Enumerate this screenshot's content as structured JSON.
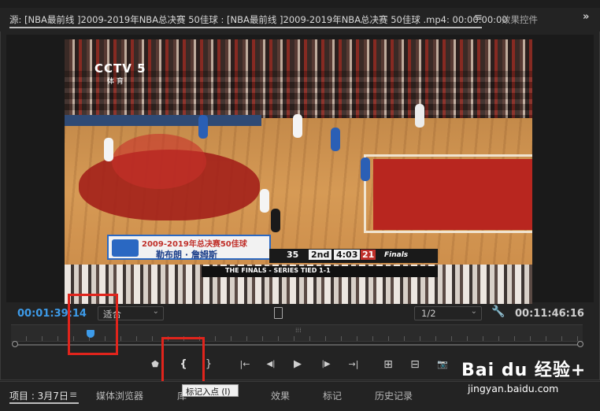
{
  "source_tab": {
    "label": "源: [NBA最前线 ]2009-2019年NBA总决赛 50佳球 : [NBA最前线 ]2009-2019年NBA总决赛 50佳球 .mp4: 00:00:00:00",
    "menu_glyph": "≡"
  },
  "effects_tab": {
    "label": "效果控件"
  },
  "overflow_glyph": "»",
  "video": {
    "cctv_logo": "CCTV 5",
    "cctv_sub": "体 育",
    "scorebug": {
      "title": "2009-2019年总决赛50佳球",
      "player_name": "勒布朗 · 詹姆斯",
      "score_home": "35",
      "quarter": "2nd",
      "clock": "4:03",
      "shot_clock": "21",
      "finals_logo": "Finals",
      "banner": "THE FINALS - SERIES TIED 1-1"
    },
    "court_text": "lines"
  },
  "controls_bar": {
    "timecode_current": "00:01:39:14",
    "fit_value": "适合",
    "resolution_value": "1/2",
    "timecode_duration": "00:11:46:16"
  },
  "transport": {
    "add_marker": "⬟",
    "mark_in": "{",
    "mark_out": "}",
    "go_to_in": "|←",
    "step_back": "◀|",
    "play": "▶",
    "step_forward": "|▶",
    "go_to_out": "→|",
    "insert": "⊞",
    "overwrite": "⊟",
    "export_frame": "📷"
  },
  "tooltip": {
    "text": "标记入点 (I)"
  },
  "bottom_tabs": [
    {
      "label": "项目 : 3月7日",
      "active": true
    },
    {
      "label": "≡",
      "active": false
    },
    {
      "label": "媒体浏览器",
      "active": false
    },
    {
      "label": "库",
      "active": false
    },
    {
      "label": "效果",
      "active": false
    },
    {
      "label": "标记",
      "active": false
    },
    {
      "label": "历史记录",
      "active": false
    }
  ],
  "watermark": {
    "brand": "Bai du 经验+",
    "url": "jingyan.baidu.com"
  },
  "colors": {
    "accent_blue": "#3d9be9",
    "highlight_red": "#e0241c",
    "panel_bg": "#232323"
  }
}
